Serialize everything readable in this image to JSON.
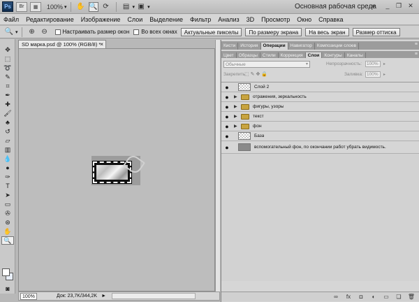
{
  "titlebar": {
    "logo": "Ps",
    "bridge_icon": "Br",
    "zoom": "100%",
    "workspace": "Основная рабочая среда",
    "workspace_arrow": "»",
    "minimize": "_",
    "restore": "❐",
    "close": "✕"
  },
  "menu": [
    "Файл",
    "Редактирование",
    "Изображение",
    "Слои",
    "Выделение",
    "Фильтр",
    "Анализ",
    "3D",
    "Просмотр",
    "Окно",
    "Справка"
  ],
  "options": {
    "resize_windows": "Настраивать размер окон",
    "all_windows": "Во всех окнах",
    "actual_pixels": "Актуальные пикселы",
    "fit_screen": "По размеру экрана",
    "fill_screen": "На весь экран",
    "print_size": "Размер оттиска"
  },
  "document": {
    "tab_title": "SD марка.psd @ 100% (RGB/8) *",
    "close": "×"
  },
  "status": {
    "zoom": "100%",
    "doc_info": "Док: 23,7K/344,2K",
    "arrow": "►"
  },
  "panels": {
    "row1_tabs": [
      "Кисти",
      "История",
      "Операции",
      "Навигатор",
      "Композиции слоев"
    ],
    "row1_active": 2,
    "row2_tabs": [
      "Цвет",
      "Образцы",
      "Стили",
      "Коррекция",
      "Слои",
      "Контуры",
      "Каналы"
    ],
    "row2_active": 4,
    "menu_icon": "≡",
    "blend_mode": "Обычные",
    "opacity_label": "Непрозрачность:",
    "opacity_value": "100%",
    "lock_label": "Закрепить:",
    "fill_label": "Заливка:",
    "fill_value": "100%"
  },
  "layers": [
    {
      "name": "Слой 2",
      "type": "layer",
      "thumb": "transparent"
    },
    {
      "name": "отражения, зеркальность",
      "type": "group"
    },
    {
      "name": "фигуры, узоры",
      "type": "group"
    },
    {
      "name": "текст",
      "type": "group"
    },
    {
      "name": "фон",
      "type": "group"
    },
    {
      "name": "База",
      "type": "layer",
      "thumb": "transparent"
    },
    {
      "name": "вспомогательный фон, по окончании работ убрать видимость.",
      "type": "layer",
      "thumb": "gray"
    }
  ],
  "icons": {
    "eye": "eye-icon",
    "link": "link-layers-icon",
    "fx": "fx-icon",
    "mask": "mask-icon",
    "adjustment": "adjustment-layer-icon",
    "folder": "new-group-icon",
    "new_layer": "new-layer-icon",
    "trash": "trash-icon"
  },
  "colors": {
    "canvas_bg": "#bdbdbd",
    "panel_bg": "#d6d6d6",
    "tab_strip": "#9c9c9c"
  }
}
